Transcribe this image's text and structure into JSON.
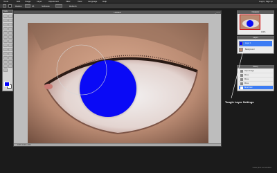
{
  "menubar": {
    "items": [
      "Tools",
      "Edit",
      "Image",
      "Layer",
      "Adjustment",
      "Filter",
      "View",
      "Language",
      "Help"
    ],
    "right": "Login | Sign up"
  },
  "options": {
    "label_a": "Radius",
    "value_a": "25",
    "label_b": "Softness",
    "label_c": "Refresh"
  },
  "tools": {
    "title": "Tools",
    "fg_color": "#0000ff",
    "bg_color": "#ffffff"
  },
  "document": {
    "title": "Untitled",
    "status": "100%  1000 x 660",
    "window_controls": "_ □ x"
  },
  "navigator": {
    "title": "Navigator",
    "zoom": "100%"
  },
  "layers": {
    "title": "Layers",
    "items": [
      {
        "label": "Layer 1",
        "selected": true
      },
      {
        "label": "Background",
        "selected": false
      }
    ]
  },
  "history": {
    "title": "History",
    "items": [
      "Open Image",
      "Move",
      "Move",
      "Move",
      "Brush tool"
    ]
  },
  "annotation": "Toogle Layer Settings",
  "credit": "www.pixlr.com/editor"
}
